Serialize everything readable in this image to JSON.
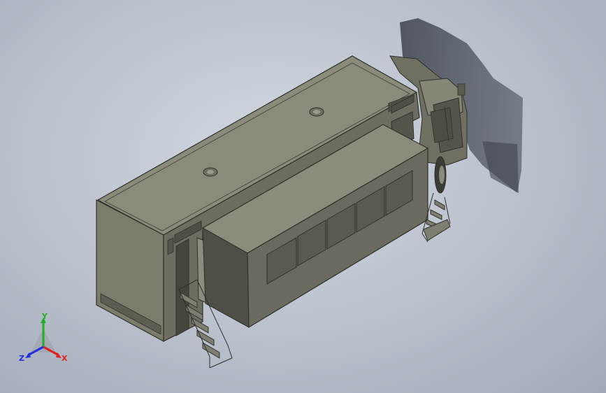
{
  "viewport": {
    "background_color": "#bcc3ce",
    "model_color": "#7b7c6c",
    "model_dark_color": "#5d5e51",
    "shadow_color": "#3e434c"
  },
  "triad": {
    "x_label": "X",
    "y_label": "Y",
    "z_label": "Z",
    "x_color": "#e02020",
    "y_color": "#20b020",
    "z_color": "#2030e0"
  }
}
